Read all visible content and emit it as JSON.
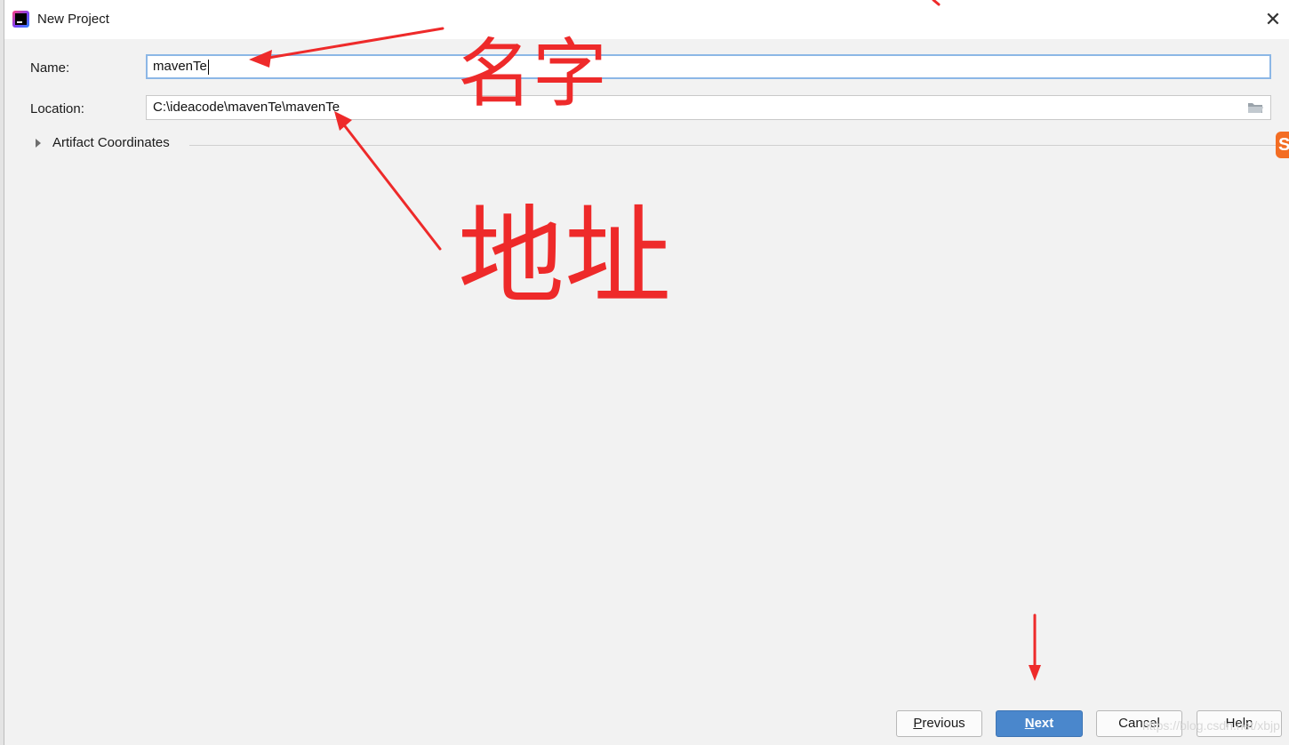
{
  "window": {
    "title": "New Project"
  },
  "form": {
    "name_label": "Name:",
    "name_value": "mavenTe",
    "location_label": "Location:",
    "location_value": "C:\\ideacode\\mavenTe\\mavenTe",
    "artifact_section": "Artifact Coordinates"
  },
  "buttons": {
    "previous_prefix": "P",
    "previous_rest": "revious",
    "next_prefix": "N",
    "next_rest": "ext",
    "cancel": "Cancel",
    "help": "Help"
  },
  "annotations": {
    "name_note": "名字",
    "location_note": "地址",
    "color": "#ee2a2a"
  },
  "watermark": "https://blog.csdn.net/xbjp",
  "side_badge": "S",
  "colors": {
    "primary_button": "#4a87cc",
    "focus_border": "#8cb7e6"
  }
}
